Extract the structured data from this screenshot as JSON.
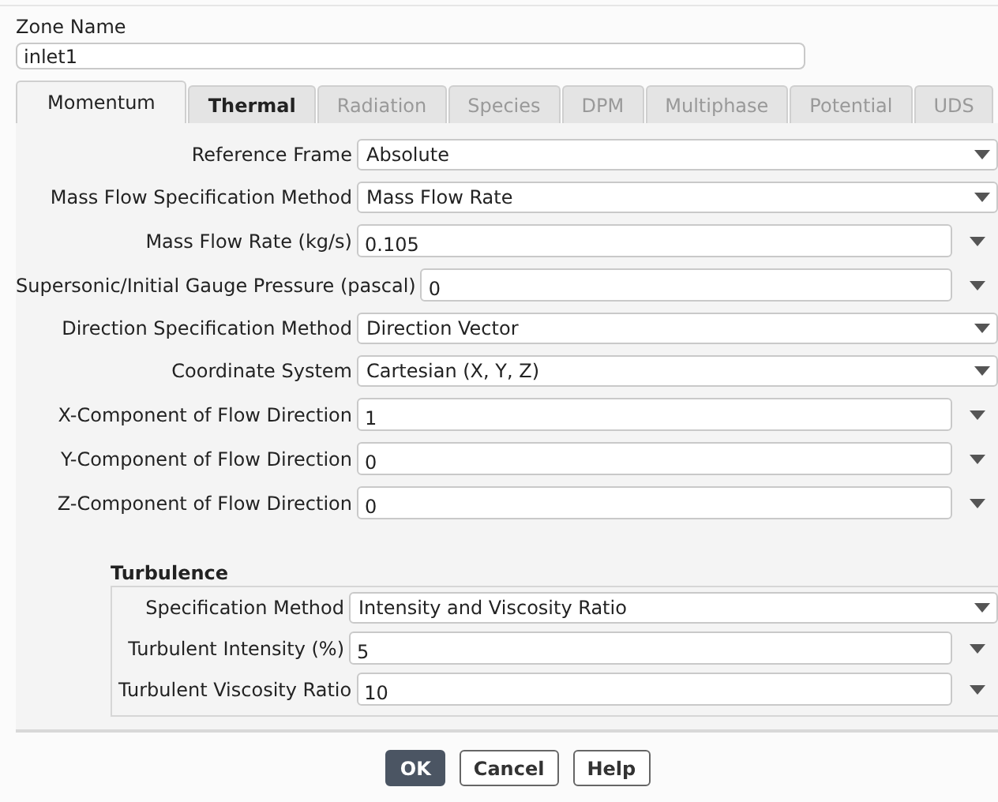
{
  "zone_name": {
    "label": "Zone Name",
    "value": "inlet1"
  },
  "tabs": [
    {
      "label": "Momentum",
      "selected": true,
      "disabled": false
    },
    {
      "label": "Thermal",
      "selected": false,
      "disabled": false
    },
    {
      "label": "Radiation",
      "selected": false,
      "disabled": true
    },
    {
      "label": "Species",
      "selected": false,
      "disabled": true
    },
    {
      "label": "DPM",
      "selected": false,
      "disabled": true
    },
    {
      "label": "Multiphase",
      "selected": false,
      "disabled": true
    },
    {
      "label": "Potential",
      "selected": false,
      "disabled": true
    },
    {
      "label": "UDS",
      "selected": false,
      "disabled": true
    }
  ],
  "fields": [
    {
      "kind": "dropdown",
      "label": "Reference Frame",
      "value": "Absolute"
    },
    {
      "kind": "dropdown",
      "label": "Mass Flow Specification Method",
      "value": "Mass Flow Rate"
    },
    {
      "kind": "input",
      "label": "Mass Flow Rate (kg/s)",
      "value": "0.105"
    },
    {
      "kind": "input",
      "label": "Supersonic/Initial Gauge Pressure (pascal)",
      "value": "0"
    },
    {
      "kind": "dropdown",
      "label": "Direction Specification Method",
      "value": "Direction Vector"
    },
    {
      "kind": "dropdown",
      "label": "Coordinate System",
      "value": "Cartesian (X, Y, Z)"
    },
    {
      "kind": "input",
      "label": "X-Component of Flow Direction",
      "value": "1"
    },
    {
      "kind": "input",
      "label": "Y-Component of Flow Direction",
      "value": "0"
    },
    {
      "kind": "input",
      "label": "Z-Component of Flow Direction",
      "value": "0"
    }
  ],
  "turbulence": {
    "title": "Turbulence",
    "fields": [
      {
        "kind": "dropdown",
        "label": "Specification Method",
        "value": "Intensity and Viscosity Ratio"
      },
      {
        "kind": "input",
        "label": "Turbulent Intensity (%)",
        "value": "5"
      },
      {
        "kind": "input",
        "label": "Turbulent Viscosity Ratio",
        "value": "10"
      }
    ]
  },
  "buttons": [
    {
      "label": "OK",
      "kind": "primary"
    },
    {
      "label": "Cancel",
      "kind": "secondary"
    },
    {
      "label": "Help",
      "kind": "secondary"
    }
  ]
}
